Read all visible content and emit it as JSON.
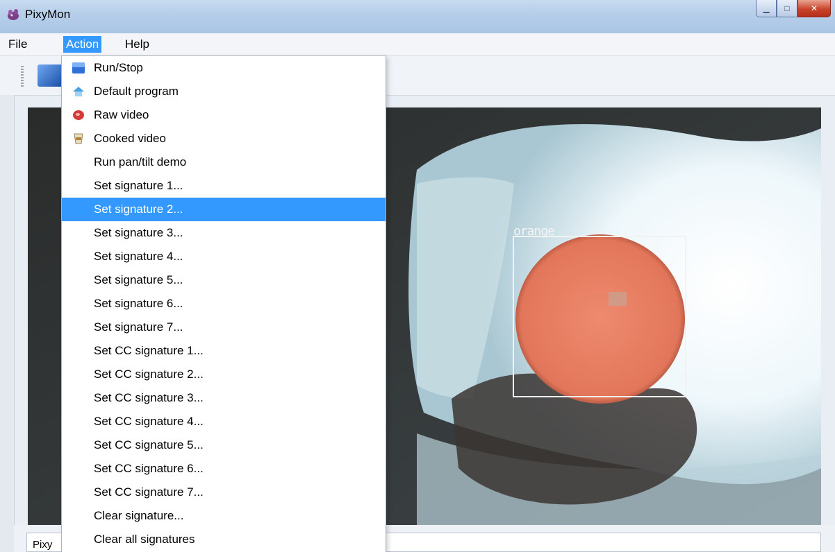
{
  "window": {
    "title": "PixyMon"
  },
  "menubar": {
    "items": [
      "File",
      "Action",
      "Help"
    ],
    "active": "Action"
  },
  "action_menu": {
    "items": [
      {
        "label": "Run/Stop",
        "icon": "run-stop-icon"
      },
      {
        "label": "Default program",
        "icon": "home-icon"
      },
      {
        "label": "Raw video",
        "icon": "raw-meat-icon"
      },
      {
        "label": "Cooked video",
        "icon": "cooked-food-icon"
      },
      {
        "label": "Run pan/tilt demo"
      },
      {
        "label": "Set signature 1..."
      },
      {
        "label": "Set signature 2...",
        "selected": true
      },
      {
        "label": "Set signature 3..."
      },
      {
        "label": "Set signature 4..."
      },
      {
        "label": "Set signature 5..."
      },
      {
        "label": "Set signature 6..."
      },
      {
        "label": "Set signature 7..."
      },
      {
        "label": "Set CC signature 1..."
      },
      {
        "label": "Set CC signature 2..."
      },
      {
        "label": "Set CC signature 3..."
      },
      {
        "label": "Set CC signature 4..."
      },
      {
        "label": "Set CC signature 5..."
      },
      {
        "label": "Set CC signature 6..."
      },
      {
        "label": "Set CC signature 7..."
      },
      {
        "label": "Clear signature..."
      },
      {
        "label": "Clear all signatures"
      }
    ]
  },
  "video": {
    "detection_label": "orange"
  },
  "status": {
    "text": "Pixy"
  },
  "colors": {
    "selection": "#3399ff",
    "detection_fill": "#e2765a",
    "close_button": "#c9432b"
  }
}
